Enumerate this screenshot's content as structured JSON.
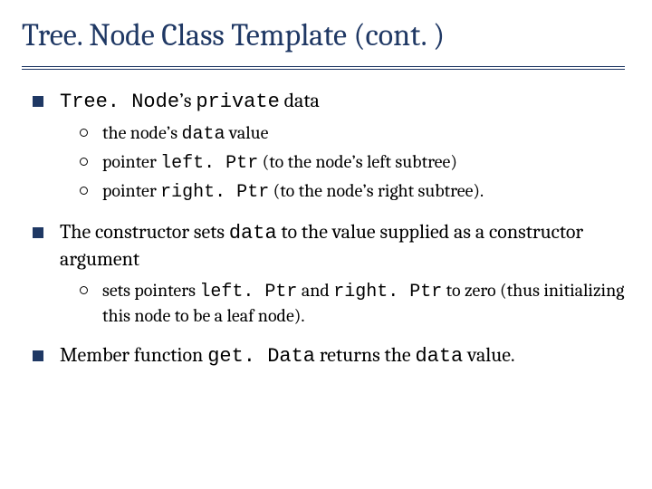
{
  "title": "Tree. Node Class Template (cont. )",
  "points": [
    {
      "parts": [
        {
          "t": "Tree. Node",
          "mono": true
        },
        {
          "t": "’s ",
          "mono": false
        },
        {
          "t": "private",
          "mono": true
        },
        {
          "t": " data",
          "mono": false
        }
      ],
      "sub": [
        {
          "parts": [
            {
              "t": "the node’s ",
              "mono": false
            },
            {
              "t": "data",
              "mono": true
            },
            {
              "t": " value",
              "mono": false
            }
          ]
        },
        {
          "parts": [
            {
              "t": "pointer ",
              "mono": false
            },
            {
              "t": "left. Ptr",
              "mono": true
            },
            {
              "t": " (to the node’s left subtree)",
              "mono": false
            }
          ]
        },
        {
          "parts": [
            {
              "t": "pointer ",
              "mono": false
            },
            {
              "t": "right. Ptr",
              "mono": true
            },
            {
              "t": " (to the node’s right subtree).",
              "mono": false
            }
          ]
        }
      ]
    },
    {
      "parts": [
        {
          "t": "The constructor sets ",
          "mono": false
        },
        {
          "t": "data",
          "mono": true
        },
        {
          "t": " to the value supplied as a constructor argument",
          "mono": false
        }
      ],
      "sub": [
        {
          "parts": [
            {
              "t": "sets pointers ",
              "mono": false
            },
            {
              "t": "left. Ptr",
              "mono": true
            },
            {
              "t": " and ",
              "mono": false
            },
            {
              "t": "right. Ptr",
              "mono": true
            },
            {
              "t": " to zero (thus initializing this node to be a leaf node).",
              "mono": false
            }
          ]
        }
      ]
    },
    {
      "parts": [
        {
          "t": "Member function ",
          "mono": false
        },
        {
          "t": "get. Data",
          "mono": true
        },
        {
          "t": " returns the ",
          "mono": false
        },
        {
          "t": "data",
          "mono": true
        },
        {
          "t": " value.",
          "mono": false
        }
      ],
      "sub": []
    }
  ]
}
